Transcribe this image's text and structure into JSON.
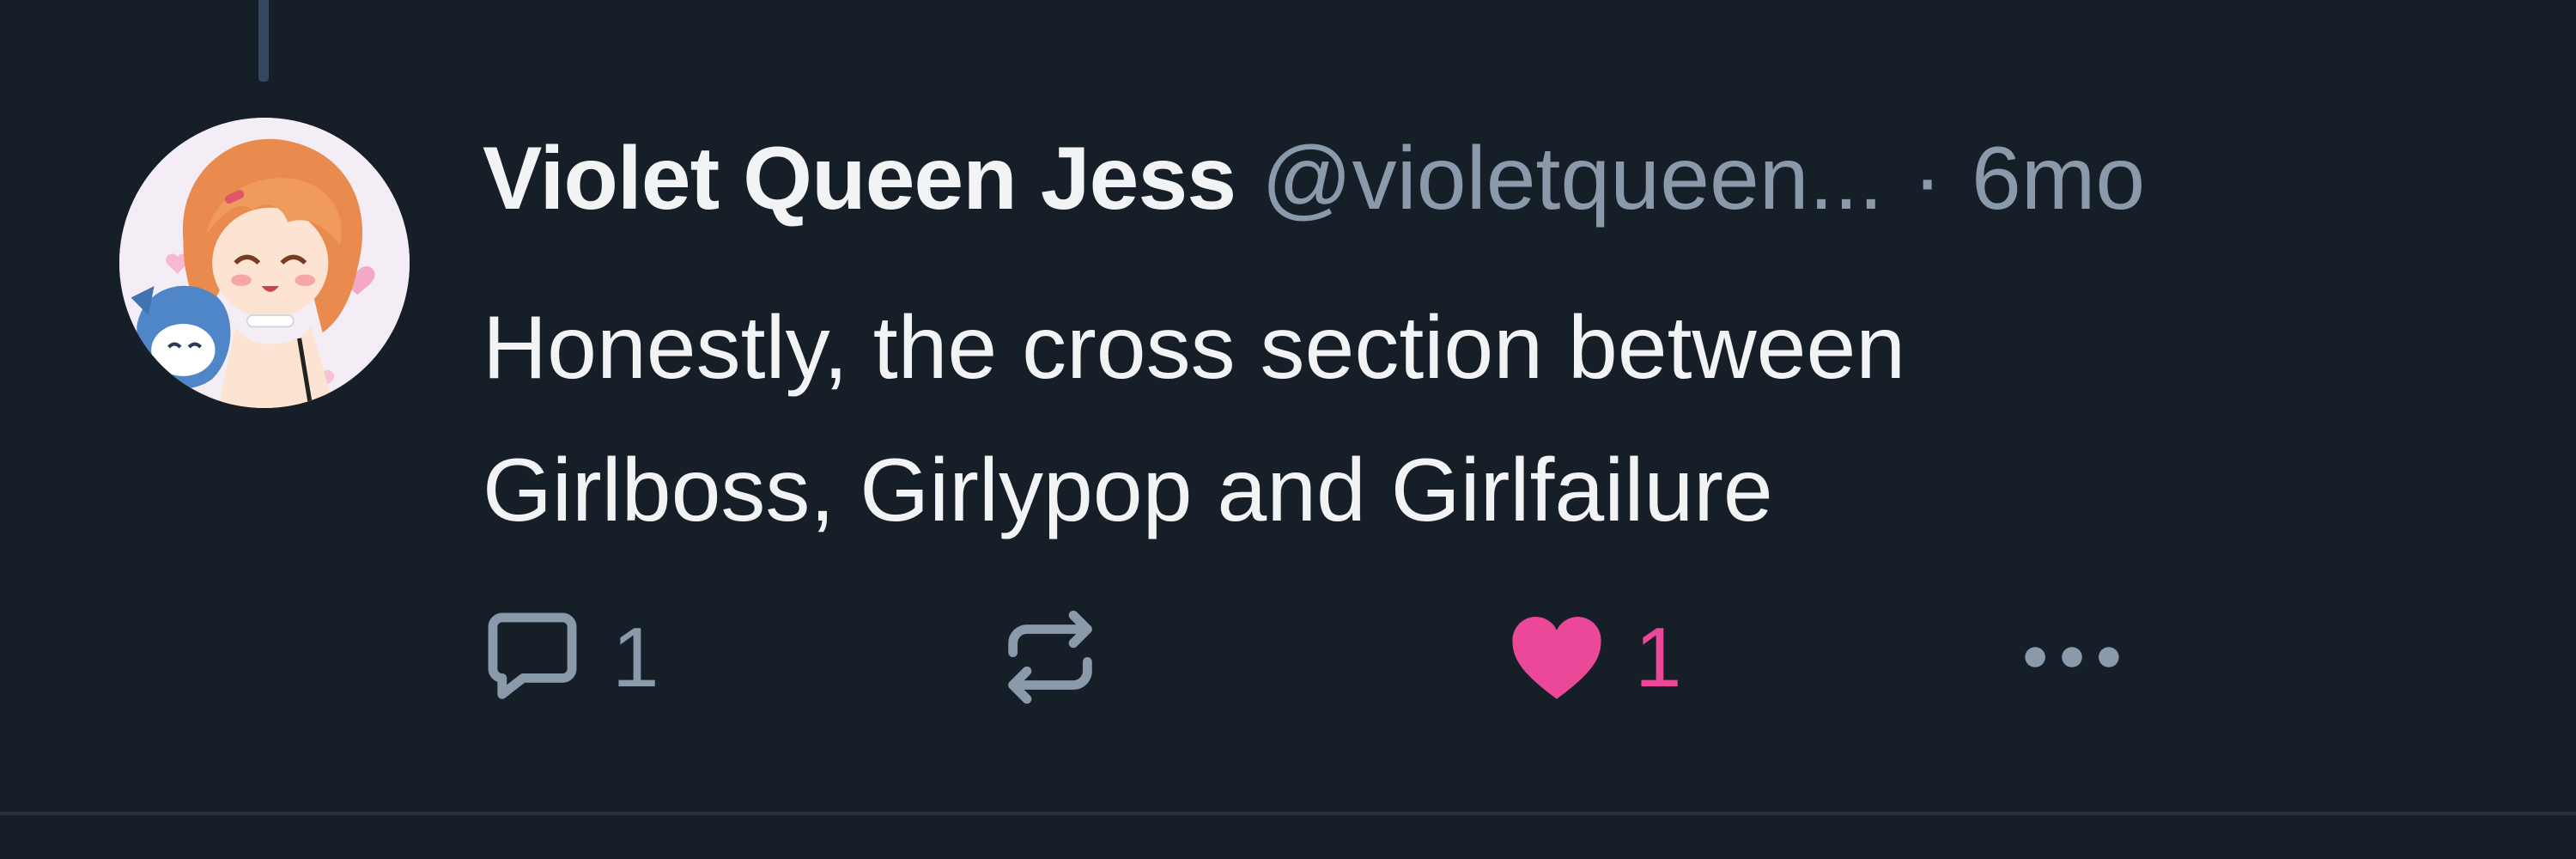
{
  "post": {
    "author": {
      "display_name": "Violet Queen Jess",
      "handle": "@violetqueen...",
      "avatar_icon": "avatar-image"
    },
    "separator": "·",
    "timestamp": "6mo",
    "text": "Honestly, the cross section between\nGirlboss, Girlypop and Girlfailure",
    "actions": {
      "reply": {
        "icon": "reply-icon",
        "count": "1"
      },
      "repost": {
        "icon": "repost-icon"
      },
      "like": {
        "icon": "heart-icon",
        "count": "1",
        "liked": true
      },
      "more": {
        "icon": "more-icon"
      }
    }
  },
  "colors": {
    "background": "#161e27",
    "primary_text": "#f1f3f5",
    "secondary_text": "#8b9aab",
    "like_accent": "#ec4899",
    "thread_line": "#34475e",
    "divider": "#26323f"
  }
}
